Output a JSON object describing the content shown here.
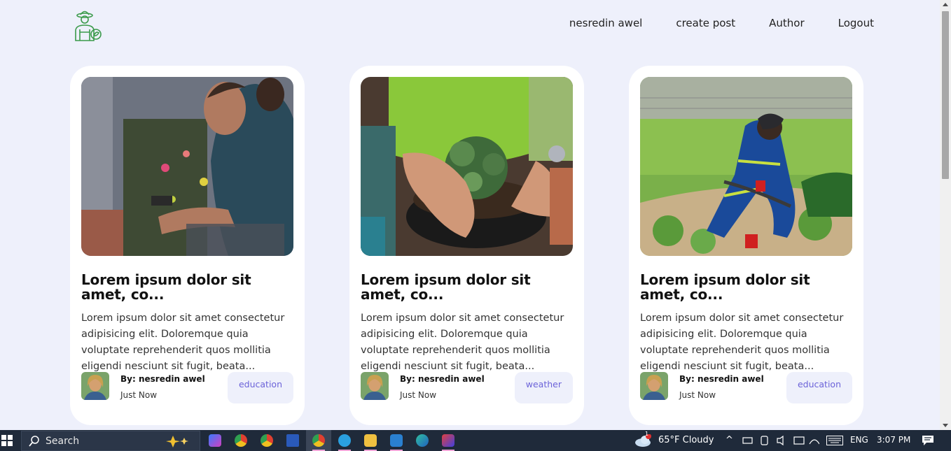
{
  "nav": {
    "items": [
      "nesredin awel",
      "create post",
      "Author",
      "Logout"
    ]
  },
  "posts": [
    {
      "title": "Lorem ipsum dolor sit amet, co...",
      "excerpt": "Lorem ipsum dolor sit amet consectetur adipisicing elit. Doloremque quia voluptate reprehenderit quos mollitia eligendi nesciunt sit fugit, beata...",
      "author": "By: nesredin awel",
      "time": "Just Now",
      "category": "education"
    },
    {
      "title": "Lorem ipsum dolor sit amet, co...",
      "excerpt": "Lorem ipsum dolor sit amet consectetur adipisicing elit. Doloremque quia voluptate reprehenderit quos mollitia eligendi nesciunt sit fugit, beata...",
      "author": "By: nesredin awel",
      "time": "Just Now",
      "category": "weather"
    },
    {
      "title": "Lorem ipsum dolor sit amet, co...",
      "excerpt": "Lorem ipsum dolor sit amet consectetur adipisicing elit. Doloremque quia voluptate reprehenderit quos mollitia eligendi nesciunt sit fugit, beata...",
      "author": "By: nesredin awel",
      "time": "Just Now",
      "category": "education"
    }
  ],
  "taskbar": {
    "search_label": "Search",
    "weather": "65°F  Cloudy",
    "weather_badge": "1",
    "language": "ENG",
    "clock": "3:07 PM"
  },
  "colors": {
    "page_bg": "#eef0fb",
    "tag_text": "#6c63d9",
    "logo": "#3a9a4a"
  }
}
